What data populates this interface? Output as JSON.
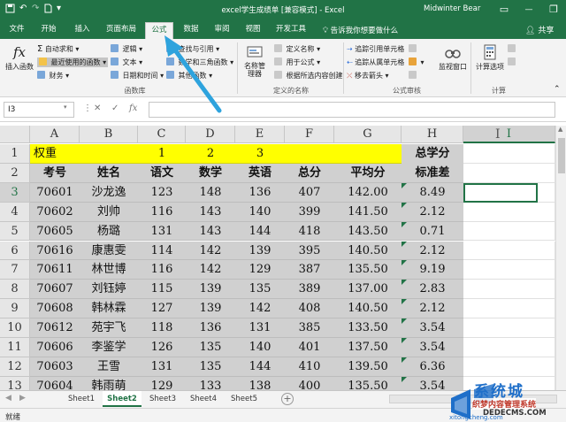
{
  "titlebar": {
    "title": "excel学生成绩单 [兼容模式] - Excel",
    "user": "Midwinter Bear",
    "min": "—",
    "restore": "❐",
    "close": "✕"
  },
  "tabs": [
    {
      "label": "文件"
    },
    {
      "label": "开始"
    },
    {
      "label": "插入"
    },
    {
      "label": "页面布局"
    },
    {
      "label": "公式"
    },
    {
      "label": "数据"
    },
    {
      "label": "审阅"
    },
    {
      "label": "视图"
    },
    {
      "label": "开发工具"
    }
  ],
  "active_tab": "公式",
  "tell_me": "告诉我你想要做什么",
  "share": "共享",
  "ribbon": {
    "insert_function": "插入函数",
    "autosum": "自动求和",
    "recent": "最近使用的函数",
    "financial": "财务",
    "logical": "逻辑",
    "text": "文本",
    "datetime": "日期和时间",
    "lookup": "查找与引用",
    "math": "数学和三角函数",
    "more": "其他函数",
    "group_library": "函数库",
    "name_manager": "名称管理器",
    "define_name": "定义名称",
    "use_in_formula": "用于公式",
    "create_from_sel": "根据所选内容创建",
    "group_names": "定义的名称",
    "trace_prec": "追踪引用单元格",
    "trace_dep": "追踪从属单元格",
    "remove_arrows": "移去箭头",
    "watch": "监视窗口",
    "group_audit": "公式审核",
    "calc_options": "计算选项",
    "group_calc": "计算"
  },
  "namebox": "I3",
  "fx": "fx",
  "columns": [
    "A",
    "B",
    "C",
    "D",
    "E",
    "F",
    "G",
    "H",
    "I"
  ],
  "rows": [
    "1",
    "2",
    "3",
    "4",
    "5",
    "6",
    "7",
    "8",
    "9",
    "10",
    "11",
    "12",
    "13"
  ],
  "row1": {
    "a": "权重",
    "c": "1",
    "d": "2",
    "e": "3",
    "h": "总学分"
  },
  "headers": [
    "考号",
    "姓名",
    "语文",
    "数学",
    "英语",
    "总分",
    "平均分",
    "标准差"
  ],
  "records": [
    [
      "70601",
      "沙龙逸",
      "123",
      "148",
      "136",
      "407",
      "142.00",
      "8.49"
    ],
    [
      "70602",
      "刘帅",
      "116",
      "143",
      "140",
      "399",
      "141.50",
      "2.12"
    ],
    [
      "70605",
      "杨璐",
      "131",
      "143",
      "144",
      "418",
      "143.50",
      "0.71"
    ],
    [
      "70616",
      "康惠雯",
      "114",
      "142",
      "139",
      "395",
      "140.50",
      "2.12"
    ],
    [
      "70611",
      "林世博",
      "116",
      "142",
      "129",
      "387",
      "135.50",
      "9.19"
    ],
    [
      "70607",
      "刘钰婷",
      "115",
      "139",
      "135",
      "389",
      "137.00",
      "2.83"
    ],
    [
      "70608",
      "韩林霖",
      "127",
      "139",
      "142",
      "408",
      "140.50",
      "2.12"
    ],
    [
      "70612",
      "苑宇飞",
      "118",
      "136",
      "131",
      "385",
      "133.50",
      "3.54"
    ],
    [
      "70606",
      "李鉴学",
      "126",
      "135",
      "140",
      "401",
      "137.50",
      "3.54"
    ],
    [
      "70603",
      "王雪",
      "131",
      "135",
      "144",
      "410",
      "139.50",
      "6.36"
    ],
    [
      "70604",
      "韩雨萌",
      "129",
      "133",
      "138",
      "400",
      "135.50",
      "3.54"
    ]
  ],
  "sheets": [
    "Sheet1",
    "Sheet2",
    "Sheet3",
    "Sheet4",
    "Sheet5"
  ],
  "active_sheet": "Sheet2",
  "status": "就绪",
  "watermark": {
    "line1": "系统城",
    "line2": "xitongcheng.com",
    "line3": "织梦内容管理系统",
    "line4": "DEDECMS.COM"
  },
  "colors": {
    "excel_green": "#217346",
    "highlight_yellow": "#ffff00",
    "range_gray": "#d0d0d0",
    "arrow_blue": "#2ea3dd"
  }
}
